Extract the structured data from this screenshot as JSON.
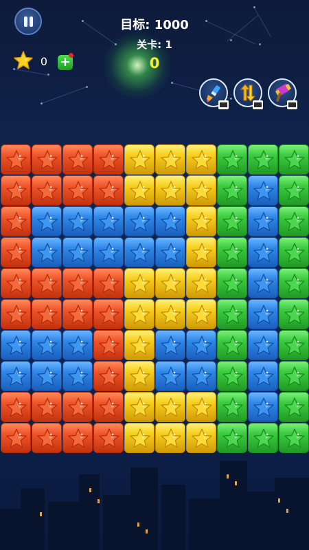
{
  "header": {
    "target_label": "目标:",
    "target_value": "1000",
    "level_label": "关卡:",
    "level_value": "1",
    "score": "0"
  },
  "coins": {
    "count": "0",
    "icon": "star-icon"
  },
  "tools": [
    {
      "name": "brush-tool",
      "icon": "paint-brush-icon"
    },
    {
      "name": "shuffle-tool",
      "icon": "swap-arrows-icon"
    },
    {
      "name": "hammer-tool",
      "icon": "hammer-icon"
    }
  ],
  "colors": {
    "red": "#f0552a",
    "yellow": "#f6cf1c",
    "green": "#3ccb3f",
    "blue": "#2f88e8"
  },
  "board": {
    "rows": 10,
    "cols": 10,
    "grid": [
      [
        "red",
        "red",
        "red",
        "red",
        "yellow",
        "yellow",
        "yellow",
        "green",
        "green",
        "green"
      ],
      [
        "red",
        "red",
        "red",
        "red",
        "yellow",
        "yellow",
        "yellow",
        "green",
        "blue",
        "green"
      ],
      [
        "red",
        "blue",
        "blue",
        "blue",
        "blue",
        "blue",
        "yellow",
        "green",
        "blue",
        "green"
      ],
      [
        "red",
        "blue",
        "blue",
        "blue",
        "blue",
        "blue",
        "yellow",
        "green",
        "blue",
        "green"
      ],
      [
        "red",
        "red",
        "red",
        "red",
        "yellow",
        "yellow",
        "yellow",
        "green",
        "blue",
        "green"
      ],
      [
        "red",
        "red",
        "red",
        "red",
        "yellow",
        "yellow",
        "yellow",
        "green",
        "blue",
        "green"
      ],
      [
        "blue",
        "blue",
        "blue",
        "red",
        "yellow",
        "blue",
        "blue",
        "green",
        "blue",
        "green"
      ],
      [
        "blue",
        "blue",
        "blue",
        "red",
        "yellow",
        "blue",
        "blue",
        "green",
        "blue",
        "green"
      ],
      [
        "red",
        "red",
        "red",
        "red",
        "yellow",
        "yellow",
        "yellow",
        "green",
        "blue",
        "green"
      ],
      [
        "red",
        "red",
        "red",
        "red",
        "yellow",
        "yellow",
        "yellow",
        "green",
        "green",
        "green"
      ]
    ]
  }
}
